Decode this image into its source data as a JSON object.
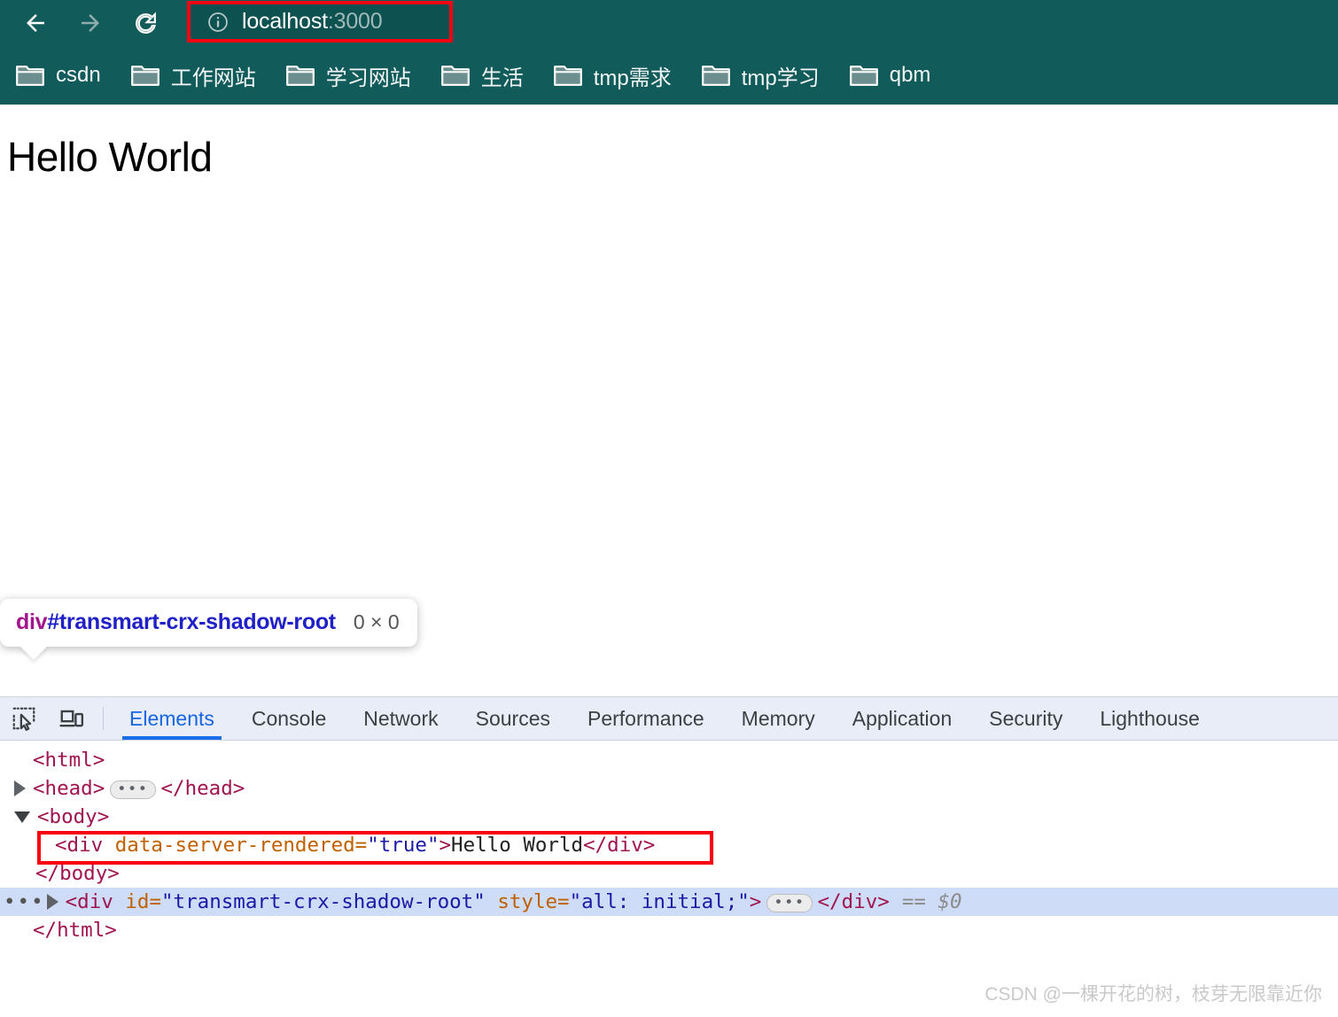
{
  "browser": {
    "nav": {
      "back_label": "Back",
      "back_icon": "arrow-left-icon",
      "forward_label": "Forward",
      "forward_icon": "arrow-right-icon",
      "reload_label": "Reload",
      "reload_icon": "reload-icon"
    },
    "url_bar": {
      "site_info_icon": "info-circle-icon",
      "host": "localhost",
      "port": ":3000",
      "full_url": "localhost:3000",
      "highlight_color": "#f60012"
    },
    "bookmarks": [
      {
        "label": "csdn",
        "icon": "folder-icon"
      },
      {
        "label": "工作网站",
        "icon": "folder-icon"
      },
      {
        "label": "学习网站",
        "icon": "folder-icon"
      },
      {
        "label": "生活",
        "icon": "folder-icon"
      },
      {
        "label": "tmp需求",
        "icon": "folder-icon"
      },
      {
        "label": "tmp学习",
        "icon": "folder-icon"
      },
      {
        "label": "qbm",
        "icon": "folder-icon"
      }
    ],
    "toolbar_color": "#115b5b"
  },
  "page": {
    "heading": "Hello World"
  },
  "inspect_tooltip": {
    "tag": "div",
    "id": "#transmart-crx-shadow-root",
    "dimensions": "0 × 0"
  },
  "devtools": {
    "inspect_icon": "inspect-element-icon",
    "device_toolbar_icon": "device-toolbar-icon",
    "tabs": [
      {
        "label": "Elements",
        "active": true
      },
      {
        "label": "Console",
        "active": false
      },
      {
        "label": "Network",
        "active": false
      },
      {
        "label": "Sources",
        "active": false
      },
      {
        "label": "Performance",
        "active": false
      },
      {
        "label": "Memory",
        "active": false
      },
      {
        "label": "Application",
        "active": false
      },
      {
        "label": "Security",
        "active": false
      },
      {
        "label": "Lighthouse",
        "active": false
      }
    ],
    "active_tab_color": "#1a6fe8",
    "dom_tree": {
      "html_open": "<html>",
      "head_open": "<head>",
      "head_ellipsis": "•••",
      "head_close": "</head>",
      "body_open": "<body>",
      "div_open_tag": "<div",
      "div_attr_name": "data-server-rendered",
      "div_attr_eq": "=",
      "div_attr_value": "\"true\"",
      "div_gt": ">",
      "div_text": "Hello World",
      "div_close": "</div>",
      "body_close": "</body>",
      "shadow_dots": "•••",
      "shadow_open_tag": "<div",
      "shadow_attr_id_name": "id",
      "shadow_attr_id_value": "\"transmart-crx-shadow-root\"",
      "shadow_attr_style_name": "style",
      "shadow_attr_style_value": "\"all: initial;\"",
      "shadow_gt": ">",
      "shadow_ellipsis": "•••",
      "shadow_close": "</div>",
      "shadow_ref": "== $0",
      "html_close": "</html>",
      "selected_row_color": "#cedcf7",
      "highlight_color": "#f60012"
    }
  },
  "watermark": {
    "text": "CSDN @一棵开花的树，枝芽无限靠近你"
  }
}
